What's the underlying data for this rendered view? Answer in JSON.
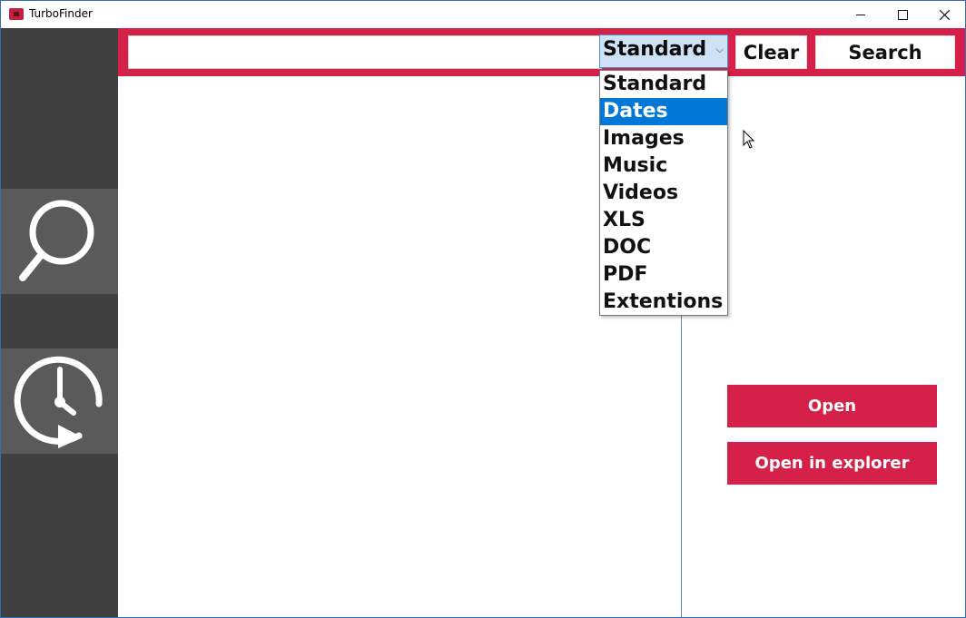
{
  "window": {
    "title": "TurboFinder"
  },
  "toolbar": {
    "search_value": "",
    "filter_selected": "Standard",
    "clear_label": "Clear",
    "search_label": "Search"
  },
  "dropdown": {
    "options": [
      "Standard",
      "Dates",
      "Images",
      "Music",
      "Videos",
      "XLS",
      "DOC",
      "PDF",
      "Extentions"
    ],
    "highlighted": "Dates"
  },
  "actions": {
    "open_label": "Open",
    "open_explorer_label": "Open in explorer"
  },
  "colors": {
    "accent": "#d5214a",
    "sidebar": "#404040",
    "sidebar_button": "#5a5a5a",
    "highlight": "#0078d7"
  },
  "icons": {
    "search_nav": "magnifier-icon",
    "history_nav": "clock-history-icon"
  }
}
